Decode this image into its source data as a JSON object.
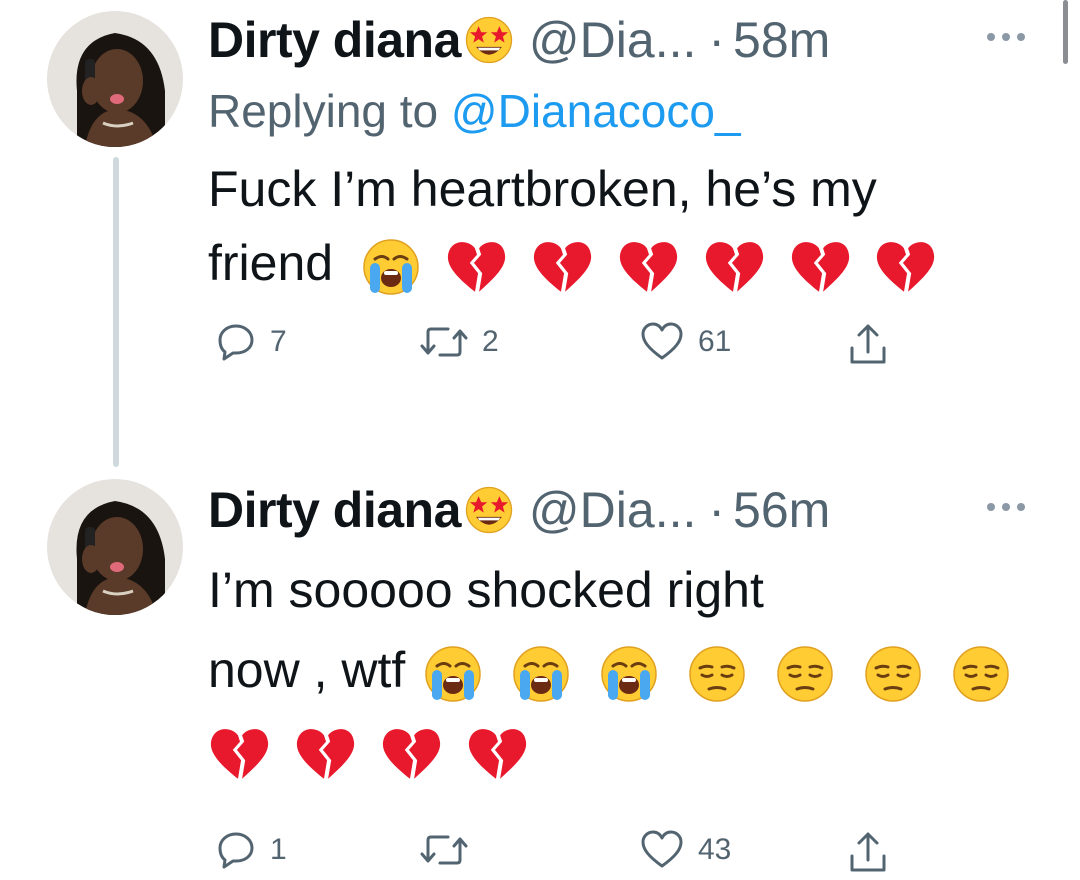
{
  "colors": {
    "link": "#1d9bf0",
    "muted": "#536471",
    "thread": "#cfd9de",
    "text": "#0f1419"
  },
  "tweets": [
    {
      "name": "Dirty diana",
      "badge": "star-struck-emoji",
      "handle": "@Dia...",
      "dot": "·",
      "time": "58m",
      "replying_prefix": "Replying to ",
      "replying_mention": "@Dianacoco_",
      "text_line1": "Fuck I’m heartbroken, he’s my",
      "text_line2": "friend",
      "text_emojis": [
        "loudly-crying-face-emoji",
        "broken-heart-emoji",
        "broken-heart-emoji",
        "broken-heart-emoji",
        "broken-heart-emoji",
        "broken-heart-emoji",
        "broken-heart-emoji"
      ],
      "reply_count": "7",
      "retweet_count": "2",
      "like_count": "61"
    },
    {
      "name": "Dirty diana",
      "badge": "star-struck-emoji",
      "handle": "@Dia...",
      "dot": "·",
      "time": "56m",
      "text_line1": "I’m sooooo shocked right",
      "text_line2": "now , wtf",
      "text_emojis_line2": [
        "loudly-crying-face-emoji",
        "loudly-crying-face-emoji",
        "loudly-crying-face-emoji",
        "pensive-face-emoji",
        "pensive-face-emoji",
        "pensive-face-emoji",
        "pensive-face-emoji"
      ],
      "text_emojis_line3": [
        "broken-heart-emoji",
        "broken-heart-emoji",
        "broken-heart-emoji",
        "broken-heart-emoji"
      ],
      "reply_count": "1",
      "retweet_count": "",
      "like_count": "43"
    }
  ]
}
